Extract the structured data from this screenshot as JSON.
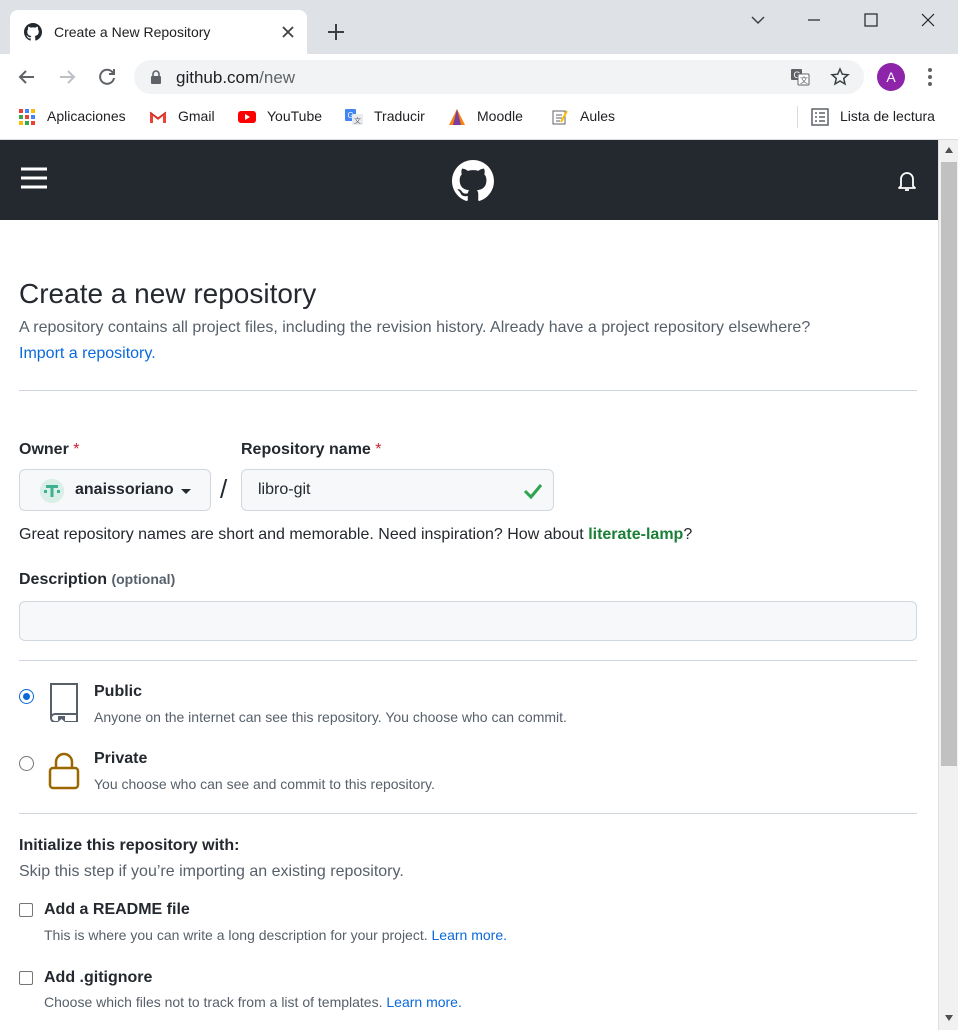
{
  "browser": {
    "tab_title": "Create a New Repository",
    "url_host": "github.com",
    "url_path": "/new",
    "profile_initial": "A",
    "bookmarks": [
      {
        "label": "Aplicaciones",
        "icon": "apps-grid-icon"
      },
      {
        "label": "Gmail",
        "icon": "gmail-icon"
      },
      {
        "label": "YouTube",
        "icon": "youtube-icon"
      },
      {
        "label": "Traducir",
        "icon": "translate-icon"
      },
      {
        "label": "Moodle",
        "icon": "moodle-icon"
      },
      {
        "label": "Aules",
        "icon": "aules-icon"
      }
    ],
    "reading_list": "Lista de lectura"
  },
  "page": {
    "title": "Create a new repository",
    "subtitle": "A repository contains all project files, including the revision history. Already have a project repository elsewhere?",
    "import_link": "Import a repository.",
    "owner_label": "Owner",
    "owner_value": "anaissoriano",
    "repo_label": "Repository name",
    "required_mark": "*",
    "slash": "/",
    "repo_value": "libro-git",
    "hint_before": "Great repository names are short and memorable. Need inspiration? How about ",
    "hint_suggestion": "literate-lamp",
    "hint_after": "?",
    "description_label": "Description",
    "description_optional": "(optional)",
    "description_value": "",
    "visibility": [
      {
        "title": "Public",
        "desc": "Anyone on the internet can see this repository. You choose who can commit.",
        "selected": true
      },
      {
        "title": "Private",
        "desc": "You choose who can see and commit to this repository.",
        "selected": false
      }
    ],
    "init_title": "Initialize this repository with:",
    "init_sub": "Skip this step if you’re importing an existing repository.",
    "options": [
      {
        "title": "Add a README file",
        "desc": "This is where you can write a long description for your project.",
        "link": "Learn more."
      },
      {
        "title": "Add .gitignore",
        "desc": "Choose which files not to track from a list of templates.",
        "link": "Learn more."
      }
    ]
  },
  "colors": {
    "header_bg": "#24292f",
    "link": "#0969da",
    "success": "#1a7f37",
    "required": "#cf222e"
  }
}
